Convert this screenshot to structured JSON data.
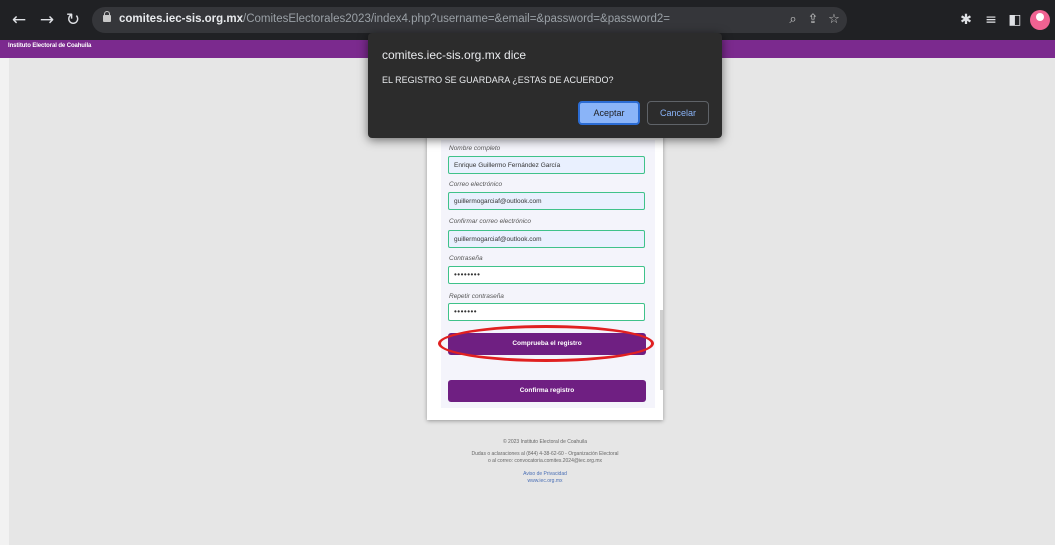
{
  "browser": {
    "url_domain": "comites.iec-sis.org.mx",
    "url_path": "/ComitesElectorales2023/index4.php?username=&email=&password=&password2="
  },
  "header": {
    "org_name": "Instituto Electoral de Coahuila"
  },
  "form": {
    "name_label": "Nombre completo",
    "name_value": "Enrique Guillermo Fernández García",
    "email_label": "Correo electrónico",
    "email_value": "guillermogarciaf@outlook.com",
    "confirm_email_label": "Confirmar correo electrónico",
    "confirm_email_value": "guillermogarciaf@outlook.com",
    "password_label": "Contraseña",
    "password_value": "••••••••",
    "repeat_password_label": "Repetir contraseña",
    "repeat_password_value": "•••••••",
    "check_button": "Comprueba el registro",
    "confirm_button": "Confirma registro"
  },
  "footer": {
    "copyright": "© 2023 Instituto Electoral de Coahuila",
    "contact_line1": "Dudas o aclaraciones al (844) 4-38-62-60 - Organización Electoral",
    "contact_line2": "o al correo: convocatoria.comites.2024@iec.org.mx",
    "privacy_link": "Aviso de Privacidad",
    "site_link": "www.iec.org.mx"
  },
  "dialog": {
    "title": "comites.iec-sis.org.mx dice",
    "message": "EL REGISTRO SE GUARDARA ¿ESTAS DE ACUERDO?",
    "accept_label": "Aceptar",
    "cancel_label": "Cancelar"
  },
  "colors": {
    "brand_purple": "#7b2a8e",
    "button_purple": "#6f1f82",
    "highlight_red": "#e02020",
    "dialog_bg": "#2c2c2c",
    "accept_blue": "#8ab4f8"
  },
  "icons": [
    "back-arrow-icon",
    "forward-arrow-icon",
    "reload-icon",
    "lock-icon",
    "zoom-icon",
    "share-icon",
    "star-icon",
    "extensions-icon",
    "reading-list-icon",
    "side-panel-icon",
    "profile-avatar-icon"
  ]
}
